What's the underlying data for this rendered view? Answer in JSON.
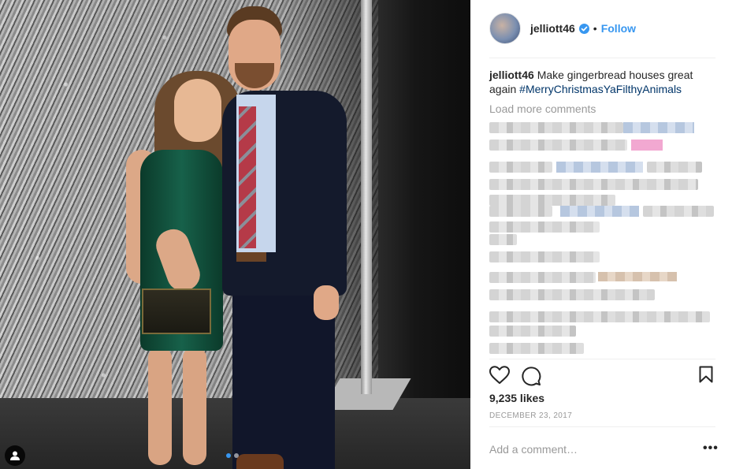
{
  "post": {
    "username": "jelliott46",
    "follow_label": "Follow",
    "bullet": "•",
    "caption_user": "jelliott46",
    "caption_text": "Make gingerbread houses great again",
    "caption_hashtag": "#MerryChristmasYaFilthyAnimals",
    "load_more": "Load more comments",
    "likes": "9,235 likes",
    "date": "DECEMBER 23, 2017",
    "comment_placeholder": "Add a comment…",
    "more_options": "•••"
  },
  "carousel": {
    "count": 2,
    "active_index": 0
  },
  "icons": {
    "verified": "verified-badge-icon",
    "like": "heart-icon",
    "comment": "comment-bubble-icon",
    "save": "bookmark-icon",
    "tag": "user-tag-icon"
  },
  "colors": {
    "link_blue": "#3897f0",
    "hashtag": "#003569",
    "muted": "#999999",
    "text": "#262626"
  }
}
